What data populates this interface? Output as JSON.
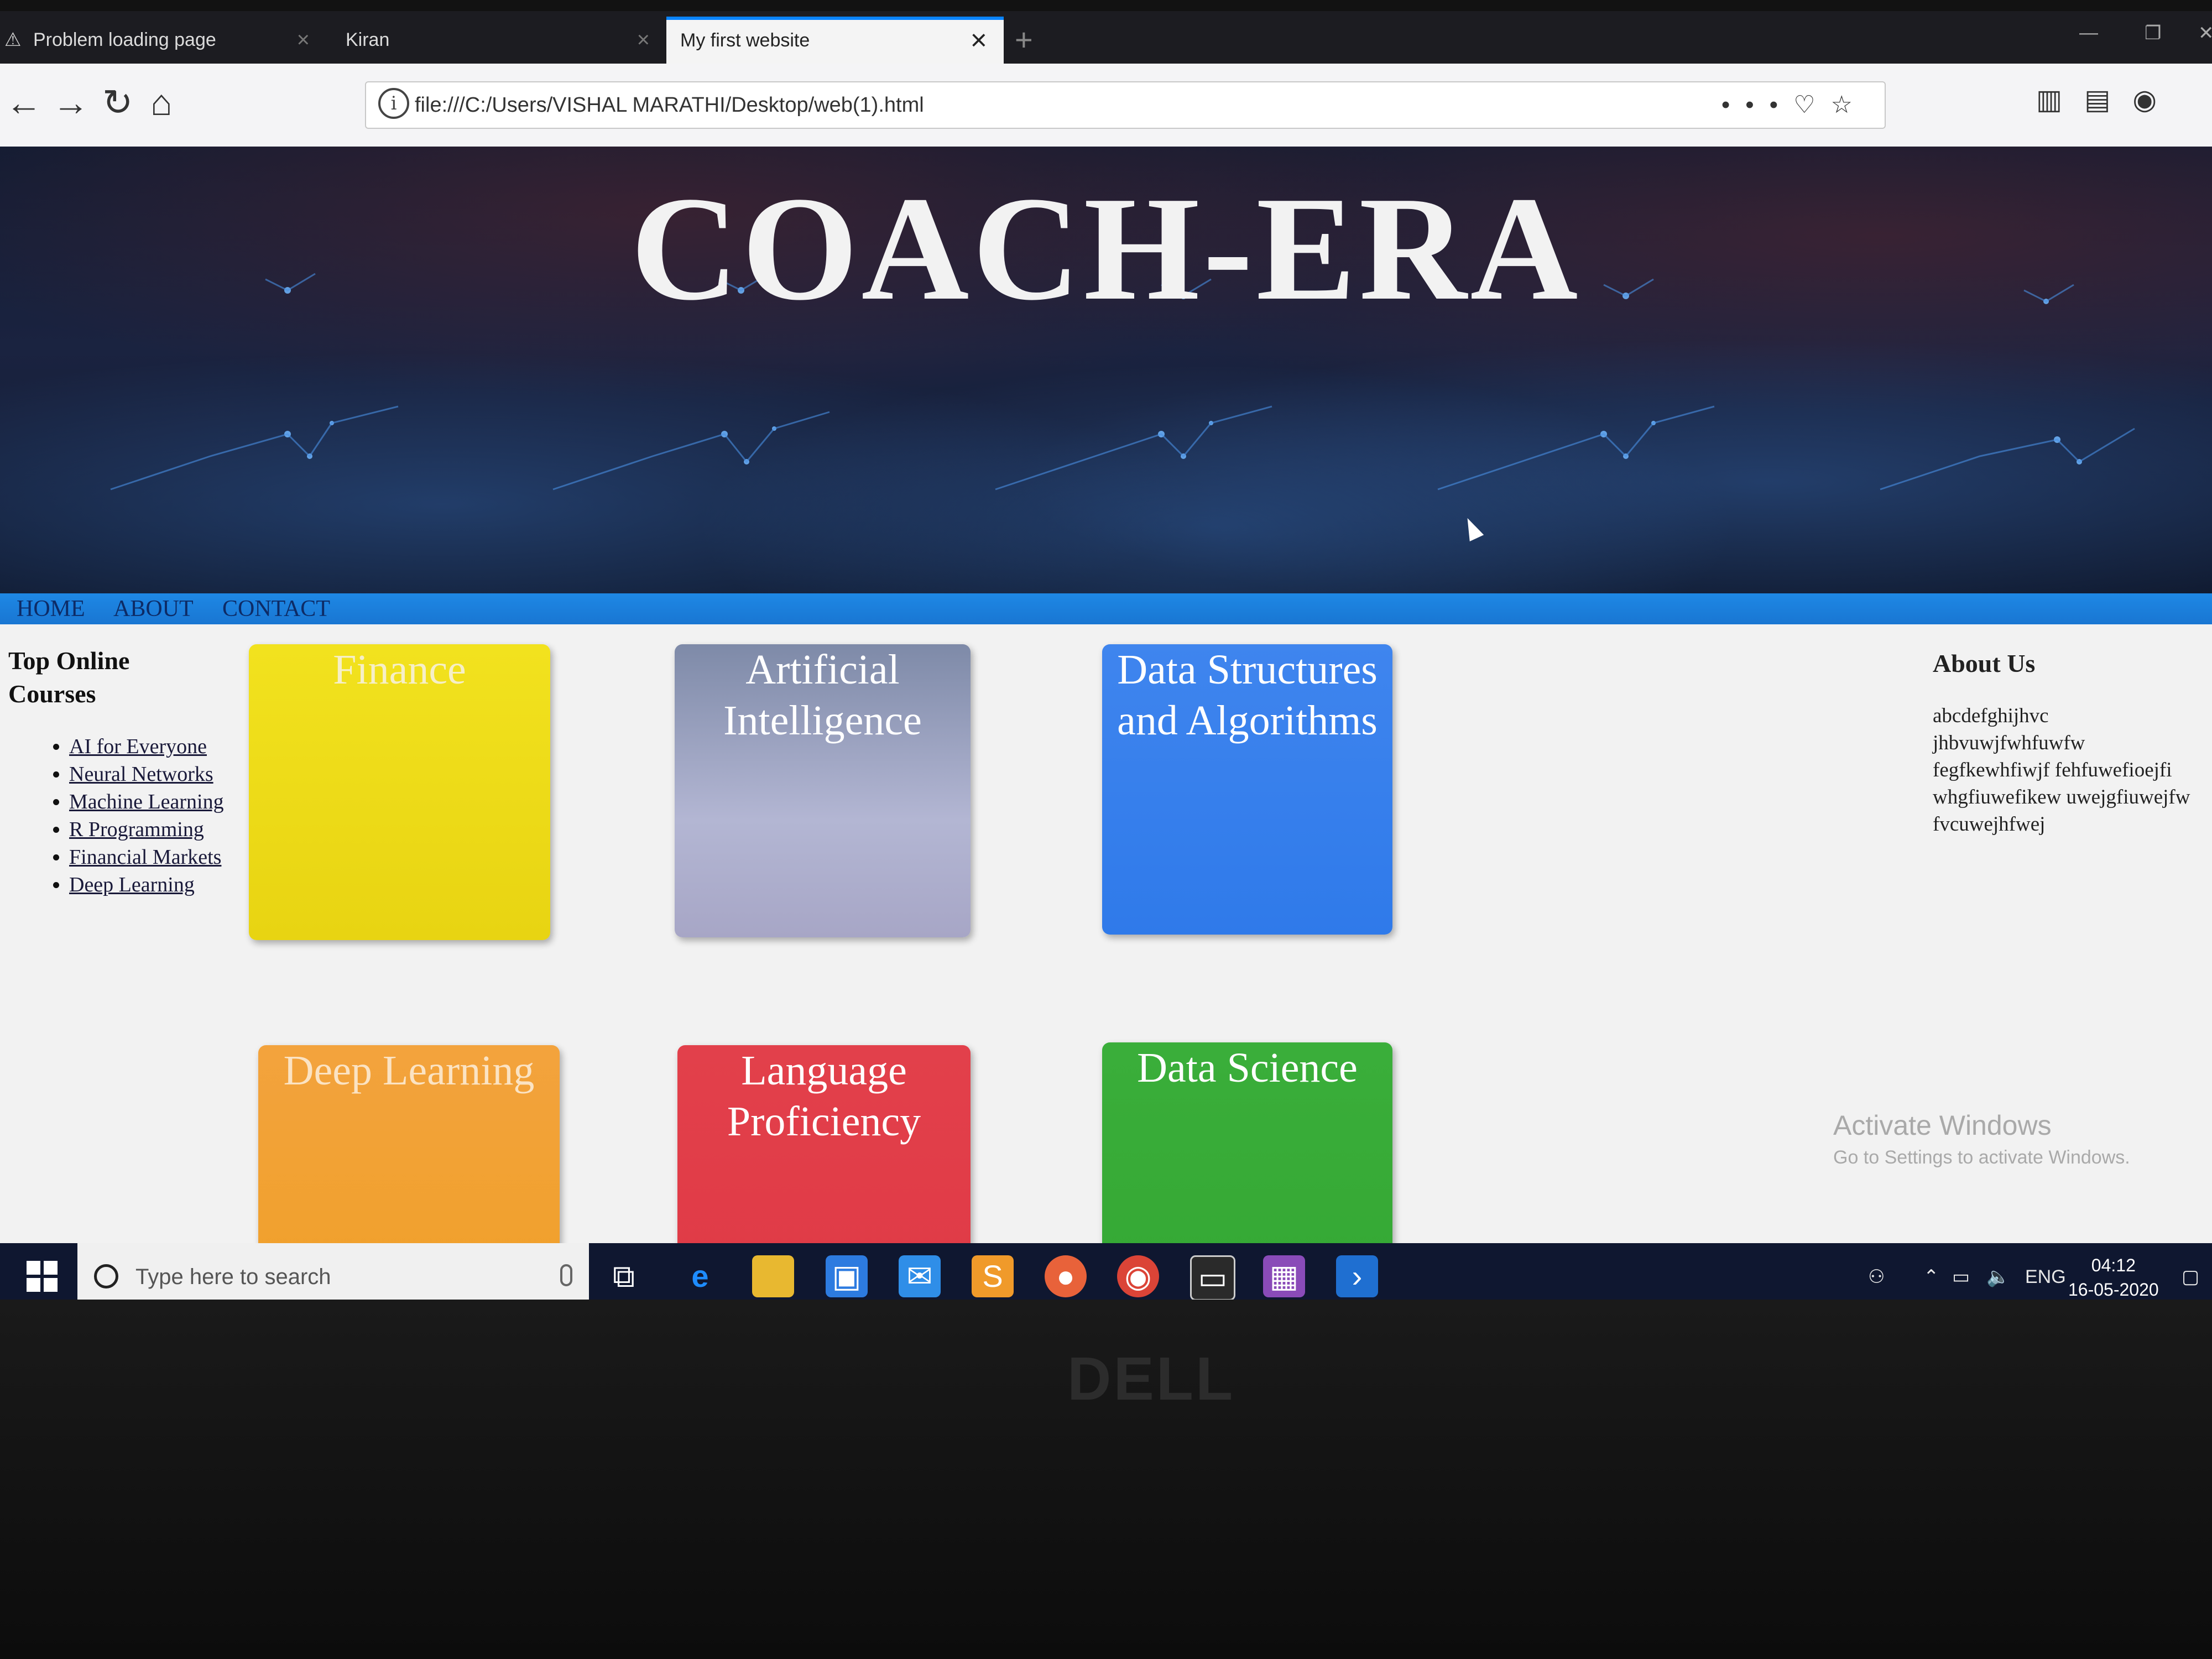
{
  "browser": {
    "tabs": [
      {
        "label": "Problem loading page",
        "active": false
      },
      {
        "label": "Kiran",
        "active": false
      },
      {
        "label": "My first website",
        "active": true
      }
    ],
    "url": "file:///C:/Users/VISHAL MARATHI/Desktop/web(1).html"
  },
  "site": {
    "title": "COACH-ERA",
    "menu": [
      "HOME",
      "ABOUT",
      "CONTACT"
    ],
    "sidebar": {
      "heading_line1": "Top Online",
      "heading_line2": "Courses",
      "links": [
        "AI for Everyone",
        "Neural Networks",
        "Machine Learning",
        "R Programming",
        "Financial Markets",
        "Deep Learning"
      ]
    },
    "cards": [
      {
        "title": "Finance",
        "color": "#f2e21e"
      },
      {
        "title": "Artificial Intelligence",
        "color": "#9ea2c2"
      },
      {
        "title": "Data Structures and Algorithms",
        "color": "#3f85ee"
      },
      {
        "title": "Deep Learning",
        "color": "#f3a33d"
      },
      {
        "title": "Language Proficiency",
        "color": "#e2404b"
      },
      {
        "title": "Data Science",
        "color": "#3aae3a"
      }
    ],
    "about": {
      "heading": "About Us",
      "text": "abcdefghijhvc jhbvuwjfwhfuwfw fegfkewhfiwjf fehfuwefioejfi whgfiuwefikew uwejgfiuwejfw fvcuwejhfwej"
    }
  },
  "watermark": {
    "line1": "Activate Windows",
    "line2": "Go to Settings to activate Windows."
  },
  "taskbar": {
    "search_placeholder": "Type here to search",
    "language": "ENG",
    "time": "04:12",
    "date": "16-05-2020"
  },
  "device": {
    "brand": "DELL"
  }
}
